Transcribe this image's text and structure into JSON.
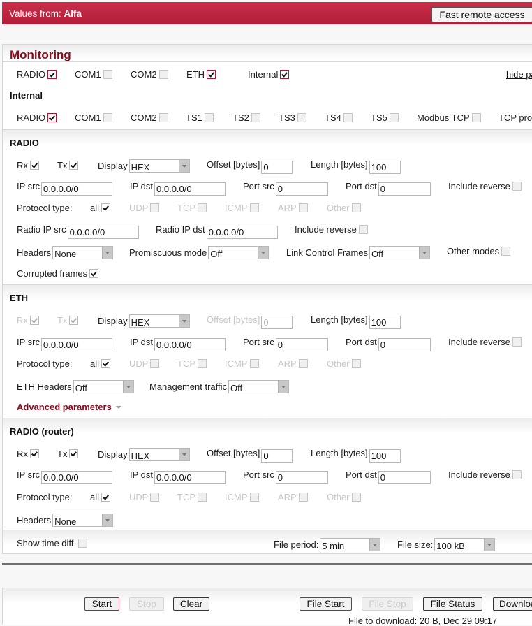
{
  "header": {
    "values_from_label": "Values from:",
    "device_name": "Alfa",
    "fast_remote_access": "Fast remote access"
  },
  "monitoring": {
    "title": "Monitoring",
    "hide_link": "hide pa",
    "interfaces": [
      {
        "label": "RADIO",
        "checked": true
      },
      {
        "label": "COM1",
        "checked": false
      },
      {
        "label": "COM2",
        "checked": false
      },
      {
        "label": "ETH",
        "checked": true
      },
      {
        "label": "Internal",
        "checked": true
      }
    ]
  },
  "internal": {
    "title": "Internal",
    "interfaces": [
      {
        "label": "RADIO",
        "checked": true
      },
      {
        "label": "COM1",
        "checked": false
      },
      {
        "label": "COM2",
        "checked": false
      },
      {
        "label": "TS1",
        "checked": false
      },
      {
        "label": "TS2",
        "checked": false
      },
      {
        "label": "TS3",
        "checked": false
      },
      {
        "label": "TS4",
        "checked": false
      },
      {
        "label": "TS5",
        "checked": false
      },
      {
        "label": "Modbus TCP",
        "checked": false
      },
      {
        "label": "TCP pro"
      }
    ]
  },
  "labels": {
    "rx": "Rx",
    "tx": "Tx",
    "display": "Display",
    "offset": "Offset [bytes]",
    "length": "Length [bytes]",
    "ip_src": "IP src",
    "ip_dst": "IP dst",
    "port_src": "Port src",
    "port_dst": "Port dst",
    "include_reverse": "Include reverse",
    "protocol_type": "Protocol type:",
    "all": "all",
    "udp": "UDP",
    "tcp": "TCP",
    "icmp": "ICMP",
    "arp": "ARP",
    "other": "Other",
    "radio_ip_src": "Radio IP src",
    "radio_ip_dst": "Radio IP dst",
    "headers": "Headers",
    "promiscuous": "Promiscuous mode",
    "link_control": "Link Control Frames",
    "other_modes": "Other modes",
    "corrupted_frames": "Corrupted frames",
    "eth_headers": "ETH Headers",
    "management_traffic": "Management traffic",
    "advanced": "Advanced parameters",
    "show_time_diff": "Show time diff.",
    "file_period": "File period:",
    "file_size": "File size:"
  },
  "radio": {
    "title": "RADIO",
    "display": "HEX",
    "offset": "0",
    "length": "100",
    "ip_src": "0.0.0.0/0",
    "ip_dst": "0.0.0.0/0",
    "port_src": "0",
    "port_dst": "0",
    "radio_ip_src": "0.0.0.0/0",
    "radio_ip_dst": "0.0.0.0/0",
    "headers": "None",
    "promiscuous": "Off",
    "link_control": "Off"
  },
  "eth": {
    "title": "ETH",
    "display": "HEX",
    "offset": "0",
    "length": "100",
    "ip_src": "0.0.0.0/0",
    "ip_dst": "0.0.0.0/0",
    "port_src": "0",
    "port_dst": "0",
    "eth_headers": "Off",
    "management_traffic": "Off"
  },
  "router": {
    "title": "RADIO (router)",
    "display": "HEX",
    "offset": "0",
    "length": "100",
    "ip_src": "0.0.0.0/0",
    "ip_dst": "0.0.0.0/0",
    "port_src": "0",
    "port_dst": "0",
    "headers": "None"
  },
  "file": {
    "period": "5 min",
    "size": "100 kB"
  },
  "buttons": {
    "start": "Start",
    "stop": "Stop",
    "clear": "Clear",
    "file_start": "File Start",
    "file_stop": "File Stop",
    "file_status": "File Status",
    "download": "Downloa"
  },
  "status": {
    "file_to_download": "File to download: 20 B, Dec 29 09:17"
  }
}
